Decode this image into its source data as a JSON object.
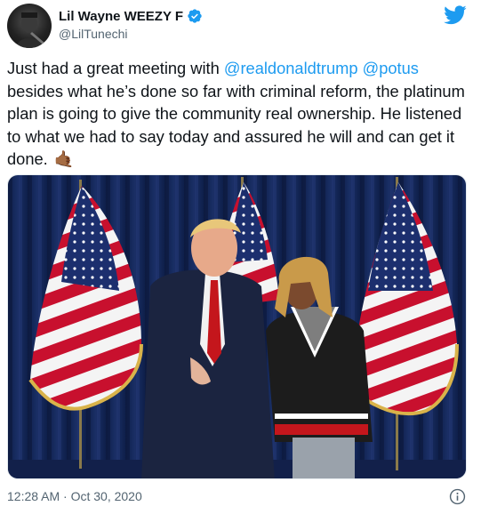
{
  "author": {
    "display_name": "Lil Wayne WEEZY F",
    "handle": "@LilTunechi"
  },
  "tweet": {
    "text_1": "Just had a great meeting with ",
    "mention_1": "@realdonaldtrump",
    "text_2": " ",
    "mention_2": "@potus",
    "text_3": " besides what he’s done so far with criminal reform, the platinum plan is going to give the community real ownership. He listened to what we had to say today and assured he will and can get it done.",
    "emoji": "🤙🏾",
    "timestamp": "12:28 AM · Oct 30, 2020"
  },
  "colors": {
    "accent": "#1d9bf0",
    "text": "#0f1419",
    "muted": "#536471"
  },
  "icons": {
    "verified": "verified-badge-icon",
    "brand": "twitter-bird-icon",
    "info": "info-icon"
  }
}
